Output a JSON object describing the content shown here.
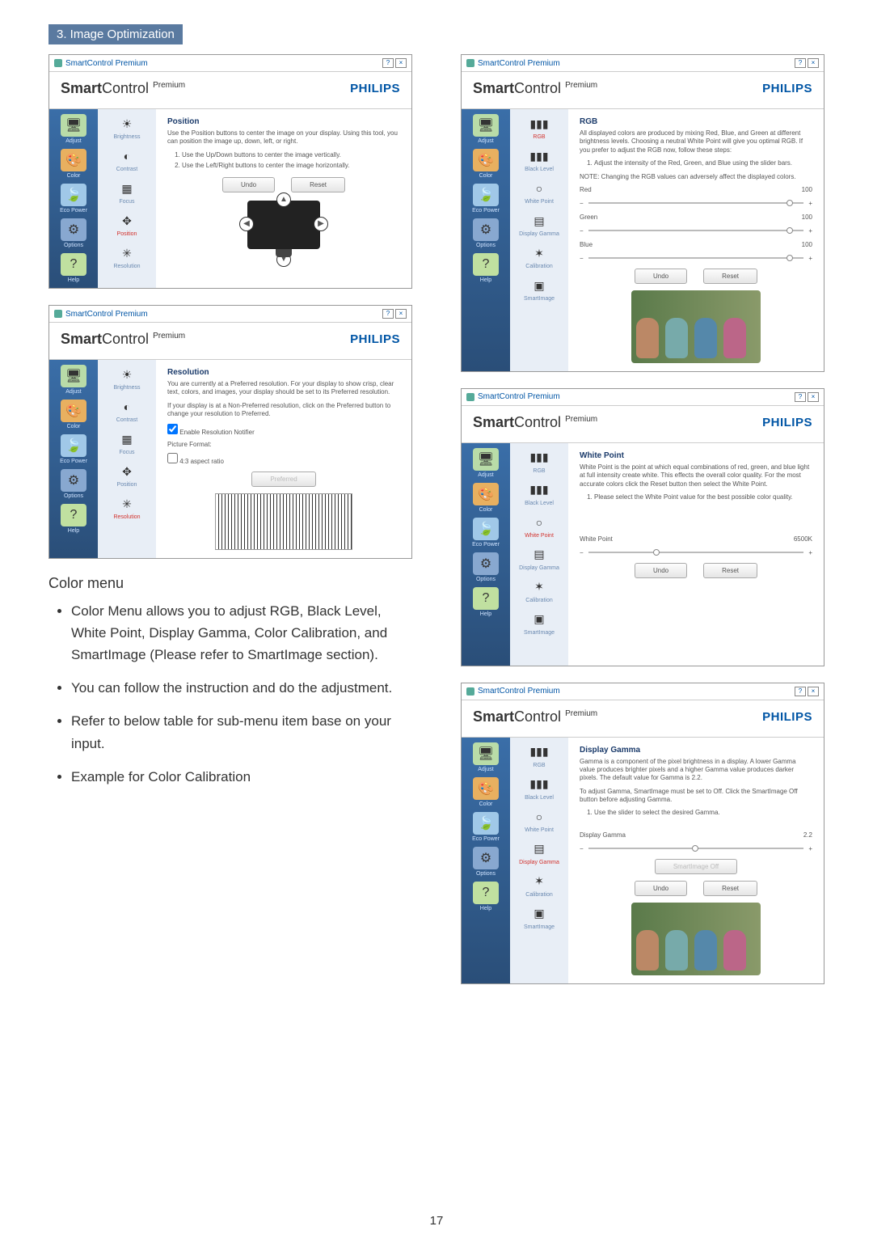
{
  "section_header": "3. Image Optimization",
  "page_number": "17",
  "brand": "PHILIPS",
  "app_title": "SmartControl Premium",
  "smart_bold": "Smart",
  "smart_reg": "Control",
  "smart_prem": "Premium",
  "nav": {
    "adjust": "Adjust",
    "color": "Color",
    "eco": "Eco Power",
    "options": "Options",
    "help": "Help"
  },
  "adjust_sub": {
    "brightness": "Brightness",
    "contrast": "Contrast",
    "focus": "Focus",
    "position": "Position",
    "resolution": "Resolution"
  },
  "color_sub": {
    "rgb": "RGB",
    "black": "Black Level",
    "white": "White Point",
    "gamma": "Display Gamma",
    "cal": "Calibration",
    "smart": "SmartImage"
  },
  "buttons": {
    "undo": "Undo",
    "reset": "Reset",
    "preferred": "Preferred",
    "smartimage_off": "SmartImage Off"
  },
  "position": {
    "title": "Position",
    "p1": "Use the Position buttons to center the image on your display. Using this tool, you can position the image up, down, left, or right.",
    "li1": "Use the Up/Down buttons to center the image vertically.",
    "li2": "Use the Left/Right buttons to center the image horizontally."
  },
  "resolution": {
    "title": "Resolution",
    "p1": "You are currently at a Preferred resolution. For your display to show crisp, clear text, colors, and images, your display should be set to its Preferred resolution.",
    "p2": "If your display is at a Non-Preferred resolution, click on the Preferred button to change your resolution to Preferred.",
    "cb": "Enable Resolution Notifier",
    "pf_title": "Picture Format:",
    "pf_cb": "4:3 aspect ratio"
  },
  "rgb": {
    "title": "RGB",
    "p1": "All displayed colors are produced by mixing Red, Blue, and Green at different brightness levels. Choosing a neutral White Point will give you optimal RGB. If you prefer to adjust the RGB now, follow these steps:",
    "li1": "Adjust the intensity of the Red, Green, and Blue using the slider bars.",
    "note": "NOTE: Changing the RGB values can adversely affect the displayed colors.",
    "red": "Red",
    "green": "Green",
    "blue": "Blue",
    "rv": "100",
    "gv": "100",
    "bv": "100"
  },
  "whitepoint": {
    "title": "White Point",
    "p1": "White Point is the point at which equal combinations of red, green, and blue light at full intensity create white. This effects the overall color quality. For the most accurate colors click the Reset button then select the White Point.",
    "li1": "Please select the White Point value for the best possible color quality.",
    "slider_label": "White Point",
    "slider_value": "6500K"
  },
  "gamma": {
    "title": "Display Gamma",
    "p1": "Gamma is a component of the pixel brightness in a display. A lower Gamma value produces brighter pixels and a higher Gamma value produces darker pixels. The default value for Gamma is 2.2.",
    "p2": "To adjust Gamma, SmartImage must be set to Off. Click the SmartImage Off button before adjusting Gamma.",
    "li1": "Use the slider to select the desired Gamma.",
    "slider_label": "Display Gamma",
    "slider_value": "2.2"
  },
  "prose": {
    "heading": "Color menu",
    "b1": "Color Menu allows you to adjust RGB, Black Level, White Point, Display Gamma, Color Calibration, and SmartImage (Please refer to SmartImage section).",
    "b2": "You can follow the instruction and do the adjustment.",
    "b3": "Refer to below table for sub-menu item base on your input.",
    "b4": "Example for Color Calibration"
  }
}
